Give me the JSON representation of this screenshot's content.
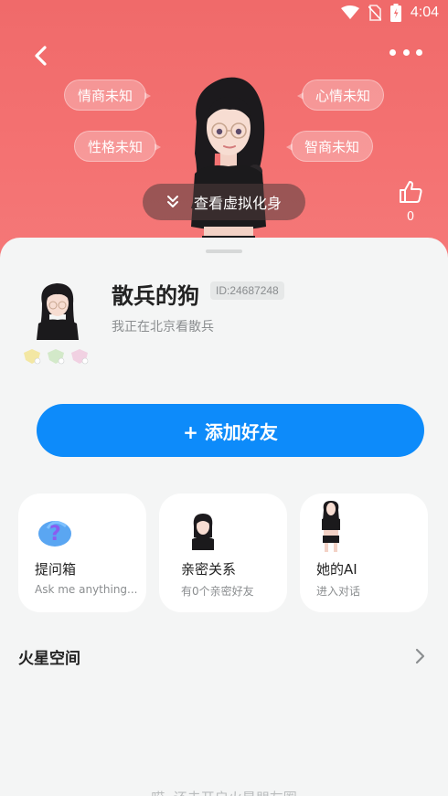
{
  "status": {
    "time": "4:04"
  },
  "hero": {
    "tags": [
      "情商未知",
      "心情未知",
      "性格未知",
      "智商未知"
    ],
    "view_avatar_label": "查看虚拟化身",
    "like_count": "0"
  },
  "profile": {
    "name": "散兵的狗",
    "id": "ID:24687248",
    "bio": "我正在北京看散兵",
    "badge_icons": [
      "yellow-badge",
      "green-badge",
      "pink-badge"
    ]
  },
  "add_friend": {
    "label": "+ 添加好友"
  },
  "cards": [
    {
      "title": "提问箱",
      "subtitle": "Ask me anything...",
      "icon": "question-box-icon"
    },
    {
      "title": "亲密关系",
      "subtitle": "有0个亲密好友",
      "icon": "intimate-avatar-icon"
    },
    {
      "title": "她的AI",
      "subtitle": "进入对话",
      "icon": "ai-avatar-icon"
    }
  ],
  "mars_space": {
    "title": "火星空间"
  },
  "bottom_hint": "哎, 还未开启火星朋友圈",
  "colors": {
    "hero": "#f06a6a",
    "accent": "#0d8bfa",
    "sheet_bg": "#f4f5f5"
  }
}
